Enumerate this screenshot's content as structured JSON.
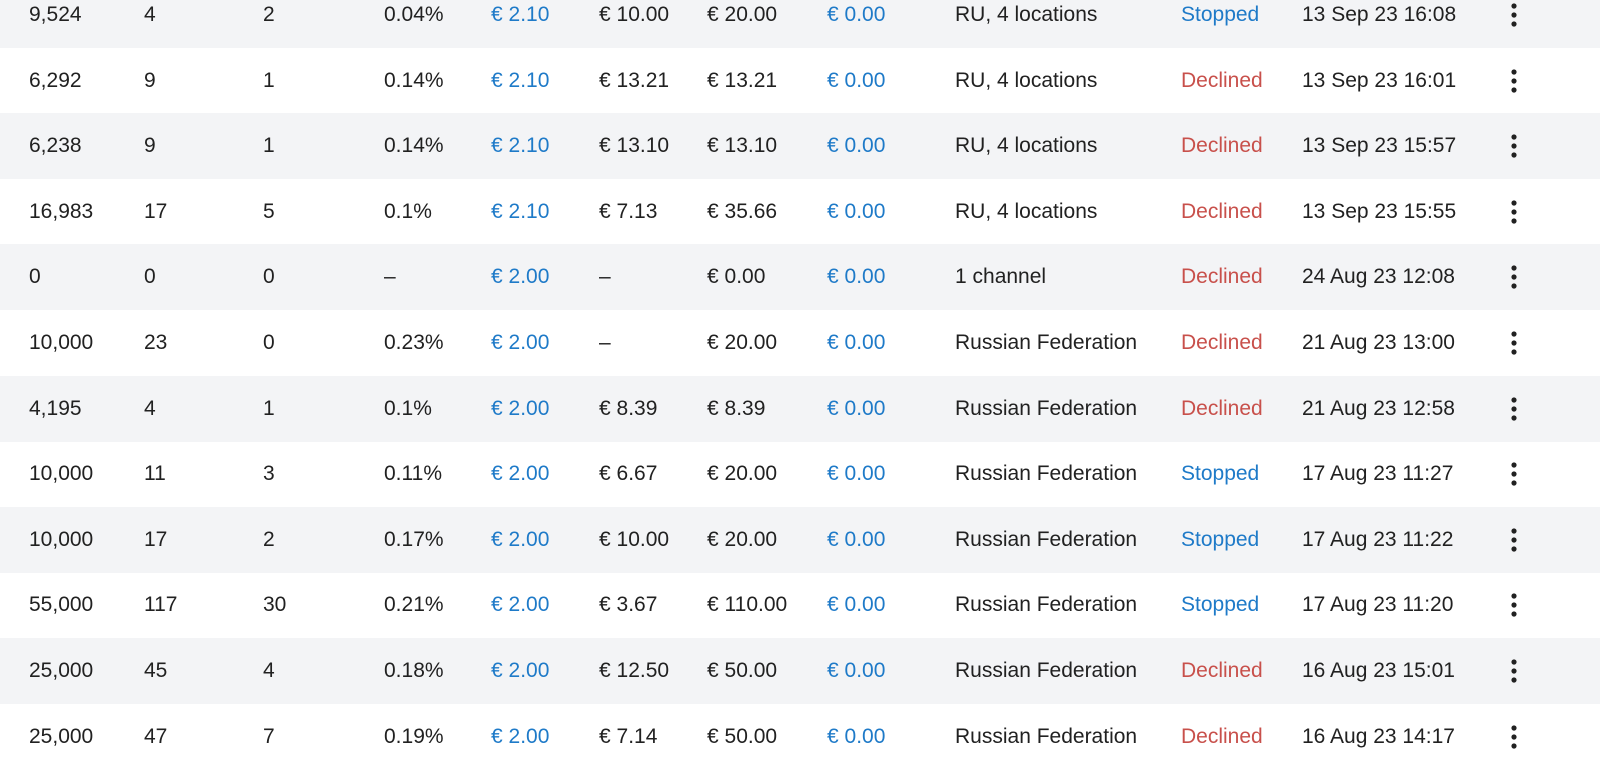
{
  "colors": {
    "row_alt_background": "#f3f4f6",
    "link_blue": "#1e7ac8",
    "declined_red": "#c8504b",
    "text": "#212121"
  },
  "row_menu_icon": "more-vertical-icon",
  "rows": [
    {
      "impressions": "9,524",
      "clicks": "4",
      "conversions": "2",
      "ctr": "0.04%",
      "bid": "€ 2.10",
      "cpa": "€ 10.00",
      "spent": "€ 20.00",
      "balance": "€ 0.00",
      "targeting": "RU, 4 locations",
      "status": "Stopped",
      "date": "13 Sep 23 16:08"
    },
    {
      "impressions": "6,292",
      "clicks": "9",
      "conversions": "1",
      "ctr": "0.14%",
      "bid": "€ 2.10",
      "cpa": "€ 13.21",
      "spent": "€ 13.21",
      "balance": "€ 0.00",
      "targeting": "RU, 4 locations",
      "status": "Declined",
      "date": "13 Sep 23 16:01"
    },
    {
      "impressions": "6,238",
      "clicks": "9",
      "conversions": "1",
      "ctr": "0.14%",
      "bid": "€ 2.10",
      "cpa": "€ 13.10",
      "spent": "€ 13.10",
      "balance": "€ 0.00",
      "targeting": "RU, 4 locations",
      "status": "Declined",
      "date": "13 Sep 23 15:57"
    },
    {
      "impressions": "16,983",
      "clicks": "17",
      "conversions": "5",
      "ctr": "0.1%",
      "bid": "€ 2.10",
      "cpa": "€ 7.13",
      "spent": "€ 35.66",
      "balance": "€ 0.00",
      "targeting": "RU, 4 locations",
      "status": "Declined",
      "date": "13 Sep 23 15:55"
    },
    {
      "impressions": "0",
      "clicks": "0",
      "conversions": "0",
      "ctr": "–",
      "bid": "€ 2.00",
      "cpa": "–",
      "spent": "€ 0.00",
      "balance": "€ 0.00",
      "targeting": "1 channel",
      "status": "Declined",
      "date": "24 Aug 23 12:08"
    },
    {
      "impressions": "10,000",
      "clicks": "23",
      "conversions": "0",
      "ctr": "0.23%",
      "bid": "€ 2.00",
      "cpa": "–",
      "spent": "€ 20.00",
      "balance": "€ 0.00",
      "targeting": "Russian Federation",
      "status": "Declined",
      "date": "21 Aug 23 13:00"
    },
    {
      "impressions": "4,195",
      "clicks": "4",
      "conversions": "1",
      "ctr": "0.1%",
      "bid": "€ 2.00",
      "cpa": "€ 8.39",
      "spent": "€ 8.39",
      "balance": "€ 0.00",
      "targeting": "Russian Federation",
      "status": "Declined",
      "date": "21 Aug 23 12:58"
    },
    {
      "impressions": "10,000",
      "clicks": "11",
      "conversions": "3",
      "ctr": "0.11%",
      "bid": "€ 2.00",
      "cpa": "€ 6.67",
      "spent": "€ 20.00",
      "balance": "€ 0.00",
      "targeting": "Russian Federation",
      "status": "Stopped",
      "date": "17 Aug 23 11:27"
    },
    {
      "impressions": "10,000",
      "clicks": "17",
      "conversions": "2",
      "ctr": "0.17%",
      "bid": "€ 2.00",
      "cpa": "€ 10.00",
      "spent": "€ 20.00",
      "balance": "€ 0.00",
      "targeting": "Russian Federation",
      "status": "Stopped",
      "date": "17 Aug 23 11:22"
    },
    {
      "impressions": "55,000",
      "clicks": "117",
      "conversions": "30",
      "ctr": "0.21%",
      "bid": "€ 2.00",
      "cpa": "€ 3.67",
      "spent": "€ 110.00",
      "balance": "€ 0.00",
      "targeting": "Russian Federation",
      "status": "Stopped",
      "date": "17 Aug 23 11:20"
    },
    {
      "impressions": "25,000",
      "clicks": "45",
      "conversions": "4",
      "ctr": "0.18%",
      "bid": "€ 2.00",
      "cpa": "€ 12.50",
      "spent": "€ 50.00",
      "balance": "€ 0.00",
      "targeting": "Russian Federation",
      "status": "Declined",
      "date": "16 Aug 23 15:01"
    },
    {
      "impressions": "25,000",
      "clicks": "47",
      "conversions": "7",
      "ctr": "0.19%",
      "bid": "€ 2.00",
      "cpa": "€ 7.14",
      "spent": "€ 50.00",
      "balance": "€ 0.00",
      "targeting": "Russian Federation",
      "status": "Declined",
      "date": "16 Aug 23 14:17"
    }
  ]
}
